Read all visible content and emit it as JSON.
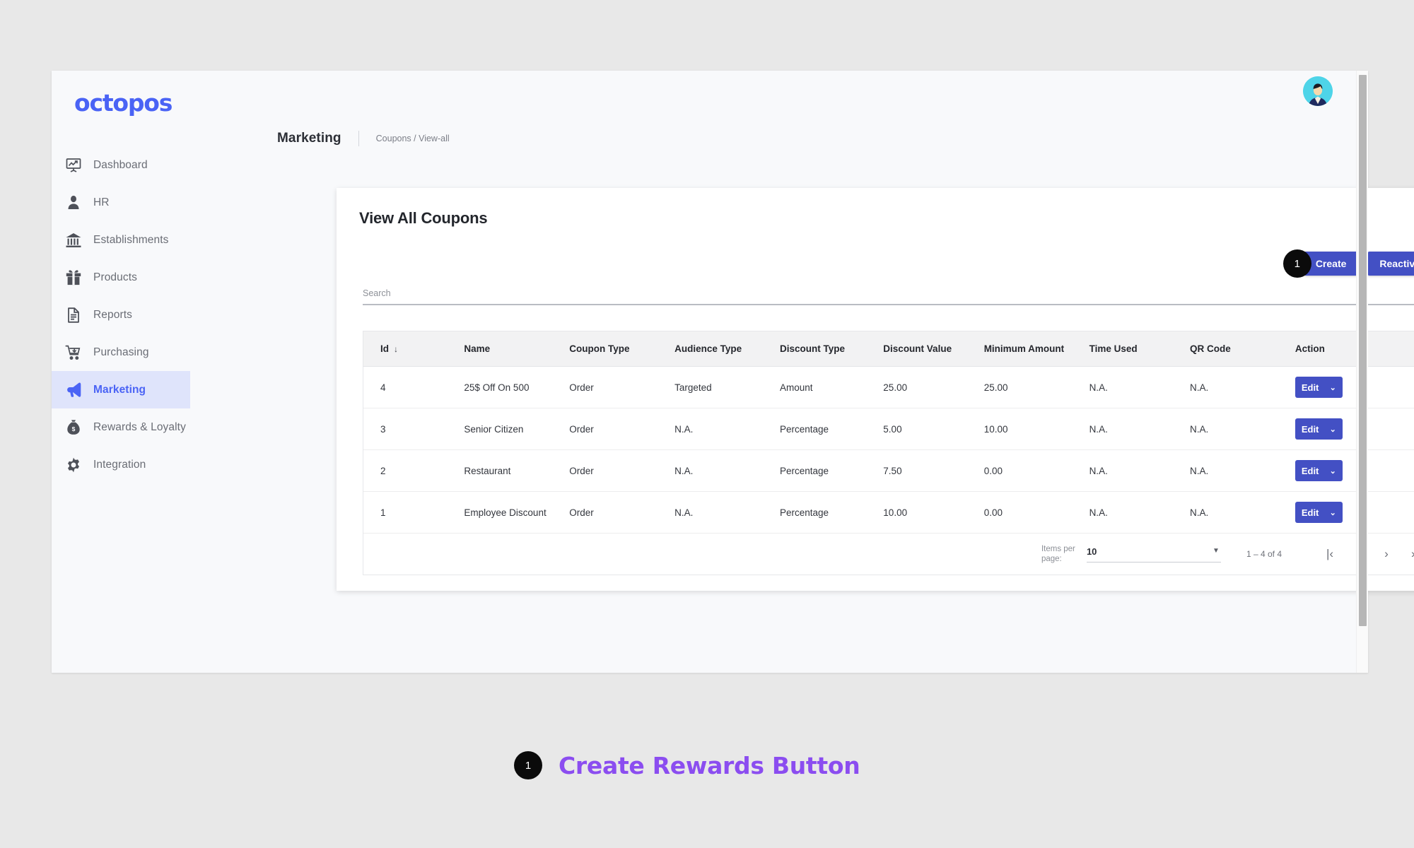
{
  "app": {
    "logo_text": "octopos"
  },
  "sidebar": {
    "items": [
      {
        "label": "Dashboard",
        "icon": "presentation-chart-icon",
        "active": false
      },
      {
        "label": "HR",
        "icon": "person-icon",
        "active": false
      },
      {
        "label": "Establishments",
        "icon": "bank-icon",
        "active": false
      },
      {
        "label": "Products",
        "icon": "gift-icon",
        "active": false
      },
      {
        "label": "Reports",
        "icon": "document-icon",
        "active": false
      },
      {
        "label": "Purchasing",
        "icon": "cart-download-icon",
        "active": false
      },
      {
        "label": "Marketing",
        "icon": "megaphone-icon",
        "active": true
      },
      {
        "label": "Rewards & Loyalty",
        "icon": "money-bag-icon",
        "active": false
      },
      {
        "label": "Integration",
        "icon": "gear-icon",
        "active": false
      }
    ]
  },
  "breadcrumb": {
    "section": "Marketing",
    "path": "Coupons / View-all"
  },
  "card": {
    "title": "View All Coupons",
    "create_label": "Create",
    "reactive_label": "Reactive",
    "create_badge": "1"
  },
  "search": {
    "label": "Search",
    "value": "",
    "placeholder": "Search"
  },
  "table": {
    "columns": [
      "Id",
      "Name",
      "Coupon Type",
      "Audience Type",
      "Discount Type",
      "Discount Value",
      "Minimum Amount",
      "Time Used",
      "QR Code",
      "Action"
    ],
    "sort_column": "Id",
    "sort_direction_glyph": "↓",
    "action_label": "Edit",
    "action_caret": "⌄",
    "rows": [
      {
        "id": "4",
        "name": "25$ Off On 500",
        "coupon_type": "Order",
        "audience_type": "Targeted",
        "discount_type": "Amount",
        "discount_value": "25.00",
        "minimum_amount": "25.00",
        "time_used": "N.A.",
        "qr_code": "N.A."
      },
      {
        "id": "3",
        "name": "Senior Citizen",
        "coupon_type": "Order",
        "audience_type": "N.A.",
        "discount_type": "Percentage",
        "discount_value": "5.00",
        "minimum_amount": "10.00",
        "time_used": "N.A.",
        "qr_code": "N.A."
      },
      {
        "id": "2",
        "name": "Restaurant",
        "coupon_type": "Order",
        "audience_type": "N.A.",
        "discount_type": "Percentage",
        "discount_value": "7.50",
        "minimum_amount": "0.00",
        "time_used": "N.A.",
        "qr_code": "N.A."
      },
      {
        "id": "1",
        "name": "Employee Discount",
        "coupon_type": "Order",
        "audience_type": "N.A.",
        "discount_type": "Percentage",
        "discount_value": "10.00",
        "minimum_amount": "0.00",
        "time_used": "N.A.",
        "qr_code": "N.A."
      }
    ]
  },
  "paginator": {
    "items_per_page_label": "Items per page:",
    "items_per_page_value": "10",
    "range_label": "1 – 4 of 4",
    "first_glyph": "|‹",
    "prev_glyph": "‹",
    "next_glyph": "›",
    "last_glyph": "›|"
  },
  "annotation": {
    "badge": "1",
    "text": "Create Rewards Button"
  },
  "colors": {
    "brand_blue": "#4a63f5",
    "button_blue": "#4350c4",
    "active_nav_bg": "#dfe4fb",
    "annotation_purple": "#8b4df0",
    "badge_black": "#0b0b0b",
    "page_bg": "#e8e8e8",
    "app_bg": "#f8f9fb"
  }
}
